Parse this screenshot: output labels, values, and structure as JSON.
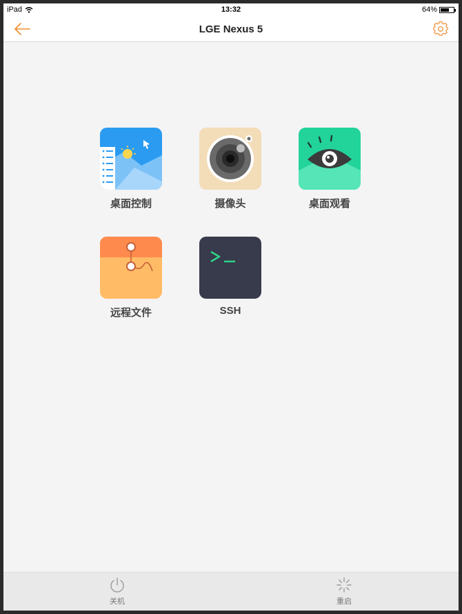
{
  "status_bar": {
    "device": "iPad",
    "time": "13:32",
    "battery_text": "64%",
    "battery_level": 0.64
  },
  "nav": {
    "title": "LGE Nexus 5",
    "back_icon": "back-arrow-icon",
    "settings_icon": "gear-icon",
    "accent_color": "#f08c2e"
  },
  "apps": [
    {
      "label": "桌面控制",
      "icon": "desktop-control-icon"
    },
    {
      "label": "摄像头",
      "icon": "camera-icon"
    },
    {
      "label": "桌面观看",
      "icon": "eye-icon"
    },
    {
      "label": "远程文件",
      "icon": "remote-files-icon"
    },
    {
      "label": "SSH",
      "icon": "terminal-icon"
    }
  ],
  "toolbar": {
    "shutdown_label": "关机",
    "shutdown_icon": "power-icon",
    "restart_label": "重启",
    "restart_icon": "restart-spinner-icon"
  }
}
